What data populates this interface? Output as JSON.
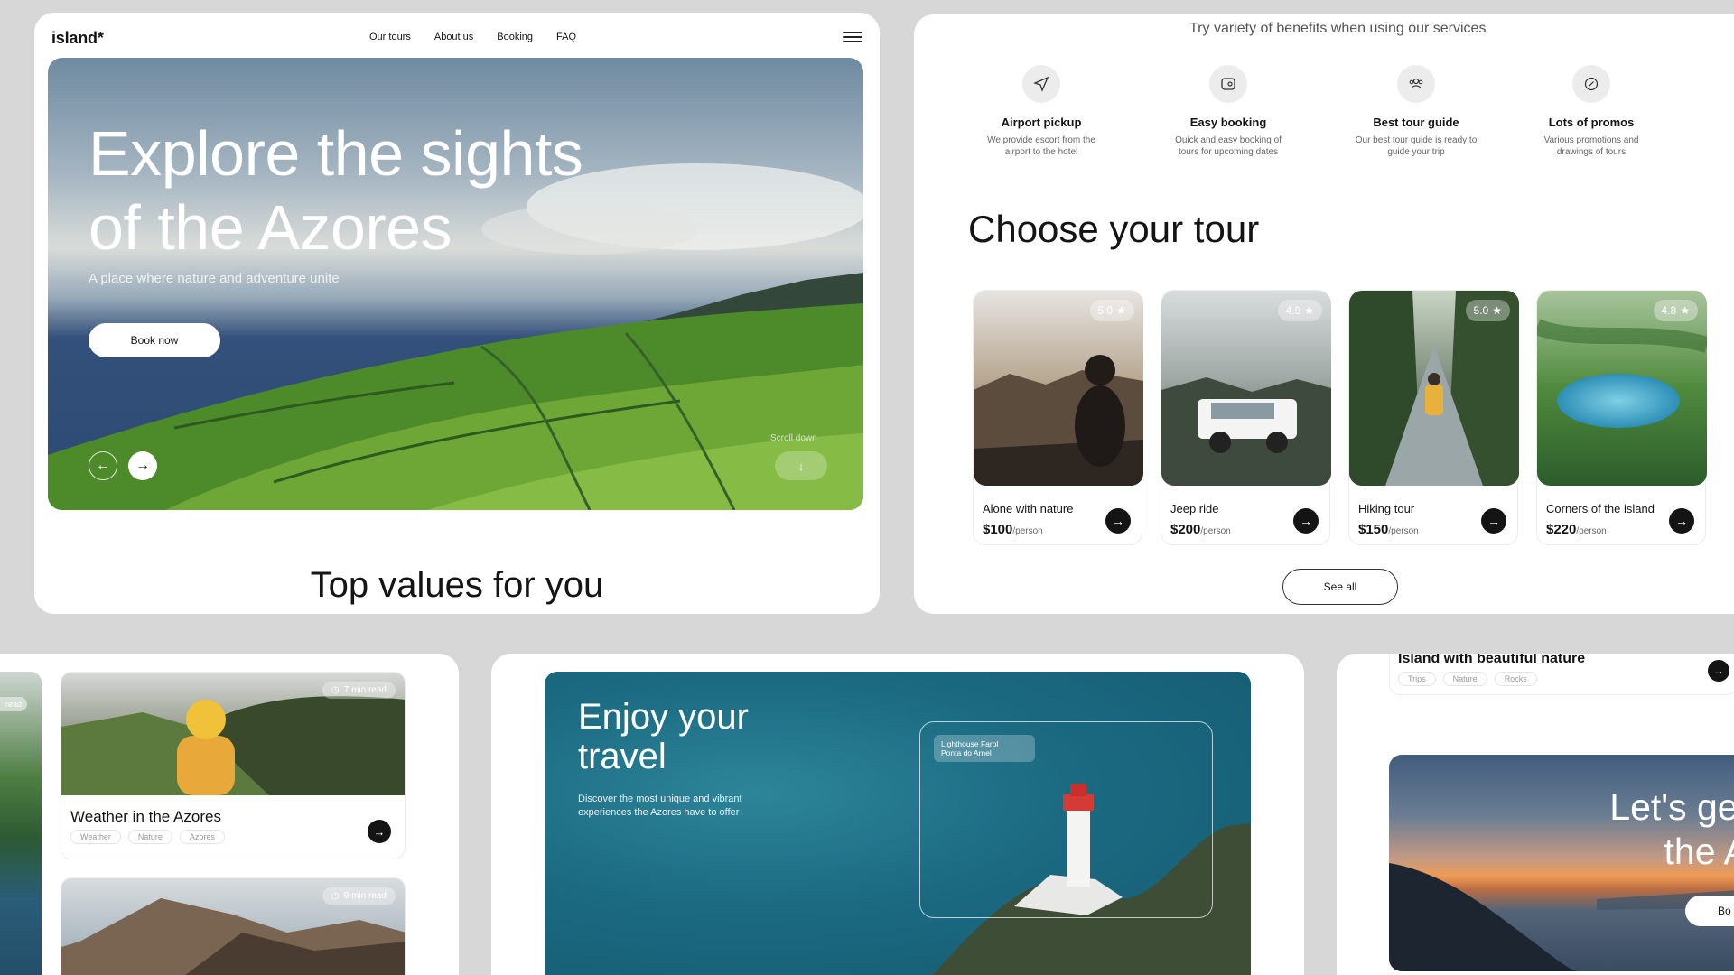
{
  "hero_page": {
    "logo": "island*",
    "nav": [
      "Our tours",
      "About us",
      "Booking",
      "FAQ"
    ],
    "headline_line1": "Explore the sights",
    "headline_line2": "of the Azores",
    "subtitle": "A place where nature and adventure unite",
    "book_button": "Book now",
    "scroll_label": "Scroll down",
    "section_title": "Top values for you"
  },
  "tours_page": {
    "benefits_title": "Try variety of benefits when using our services",
    "benefits": [
      {
        "title": "Airport pickup",
        "desc": "We provide escort from the airport to the hotel",
        "icon": "send-icon"
      },
      {
        "title": "Easy booking",
        "desc": "Quick and easy booking of tours for upcoming dates",
        "icon": "wallet-icon"
      },
      {
        "title": "Best tour guide",
        "desc": "Our best tour guide is ready to guide your trip",
        "icon": "people-icon"
      },
      {
        "title": "Lots of promos",
        "desc": "Various promotions and drawings of tours",
        "icon": "badge-percent-icon"
      }
    ],
    "section_title": "Choose your tour",
    "tours": [
      {
        "name": "Alone with nature",
        "price": "$100",
        "unit": "/person",
        "rating": "5.0"
      },
      {
        "name": "Jeep ride",
        "price": "$200",
        "unit": "/person",
        "rating": "4.9"
      },
      {
        "name": "Hiking tour",
        "price": "$150",
        "unit": "/person",
        "rating": "5.0"
      },
      {
        "name": "Corners of the island",
        "price": "$220",
        "unit": "/person",
        "rating": "4.8"
      }
    ],
    "see_all": "See all"
  },
  "blog_page": {
    "edge_badge": "read",
    "posts": [
      {
        "title": "Weather in the Azores",
        "read_time": "7 min read",
        "tags": [
          "Weather",
          "Nature",
          "Azores"
        ]
      },
      {
        "title": "",
        "read_time": "9 min read",
        "tags": []
      }
    ]
  },
  "travel_page": {
    "headline_line1": "Enjoy your",
    "headline_line2": "travel",
    "description": "Discover the most unique and vibrant experiences the Azores have to offer",
    "location_line1": "Lighthouse Farol",
    "location_line2": "Ponta do Arnel"
  },
  "cta_page": {
    "post_title": "Island with beautiful nature",
    "post_tags": [
      "Trips",
      "Nature",
      "Rocks"
    ],
    "headline_line1": "Let's get",
    "headline_line2": "the A",
    "button": "Bo"
  },
  "colors": {
    "background": "#d7d7d7",
    "dark": "#141414",
    "sea": "#1b6a82"
  }
}
